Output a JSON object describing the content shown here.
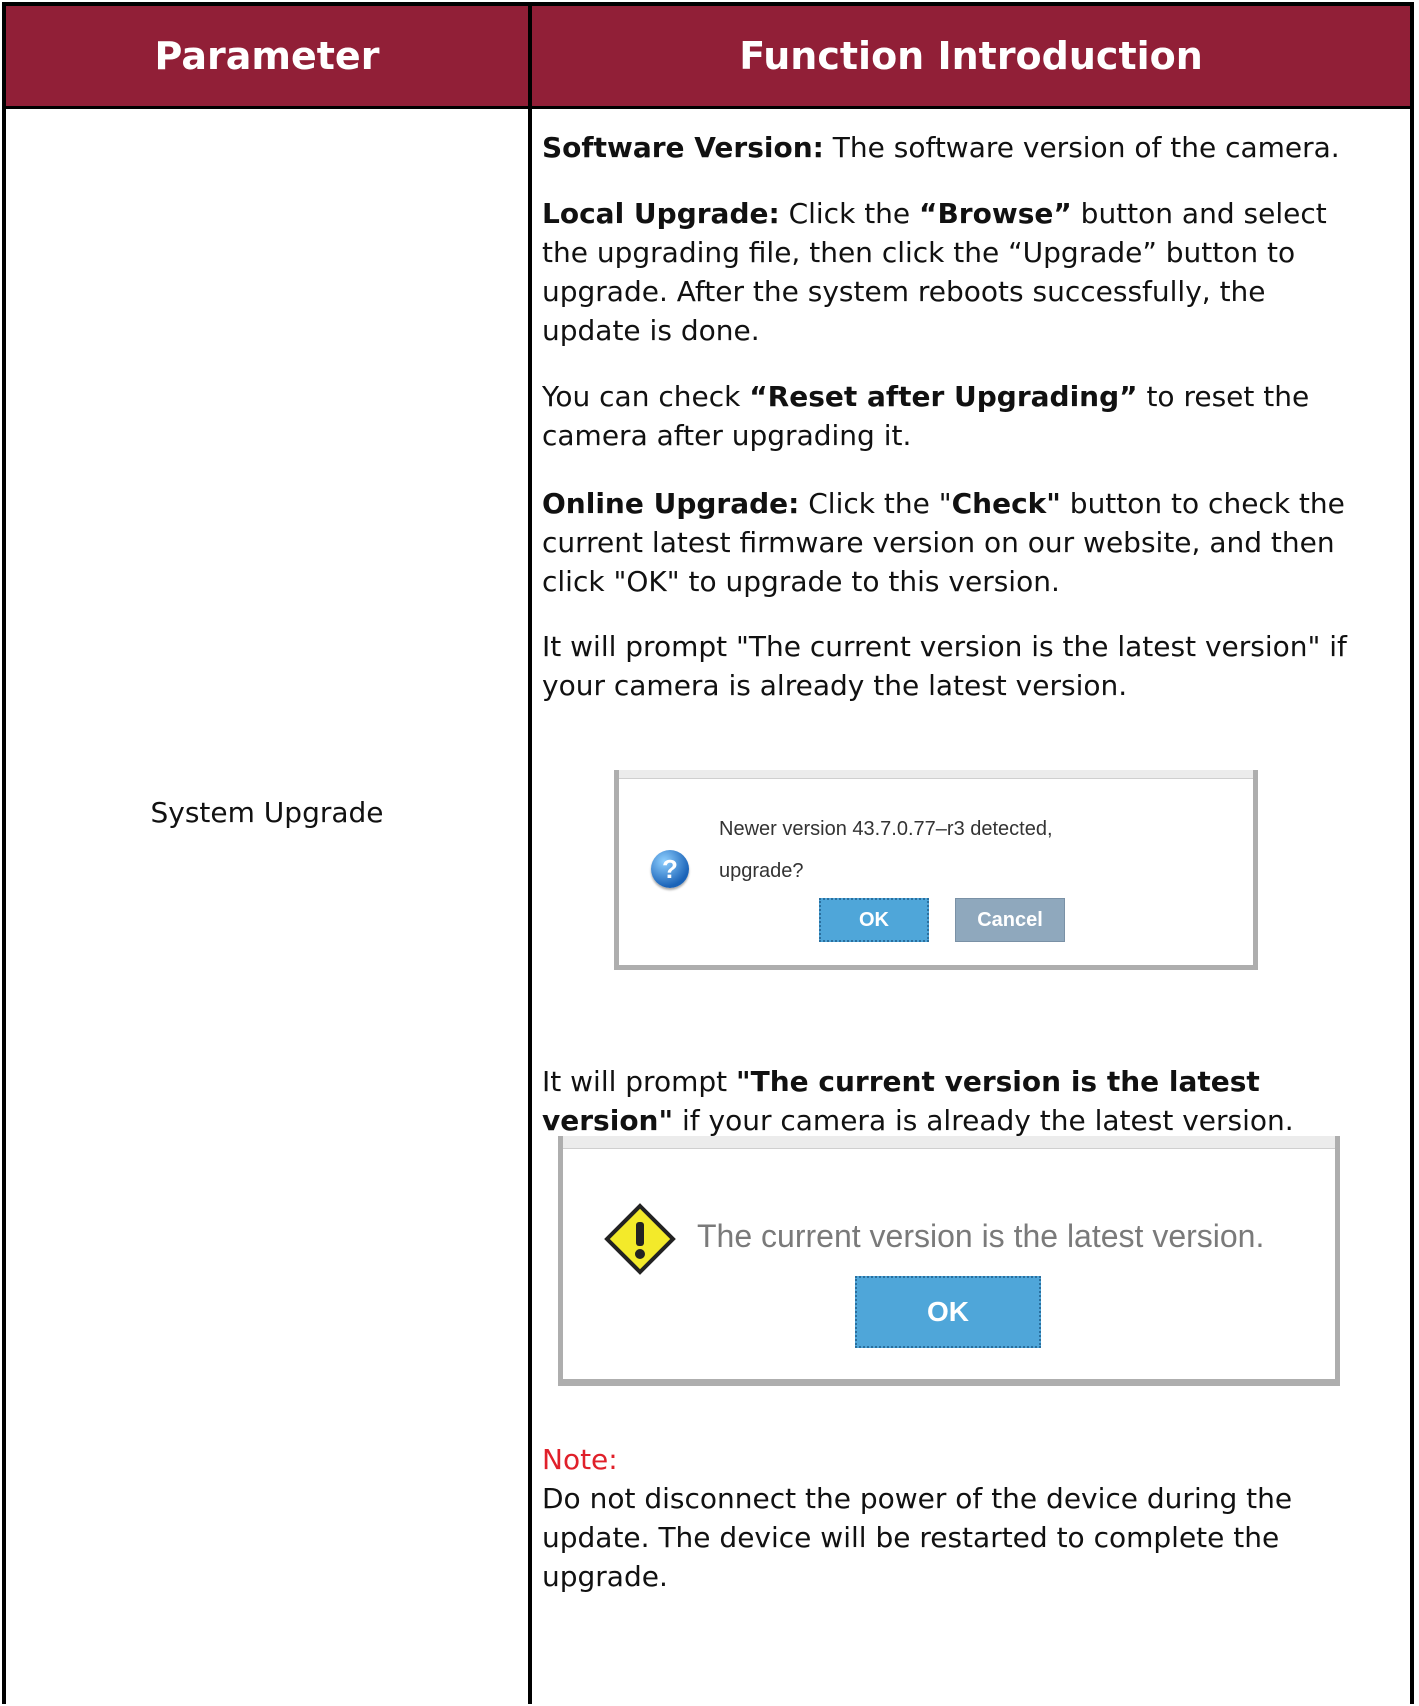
{
  "header": {
    "parameter": "Parameter",
    "function": "Function Introduction"
  },
  "row": {
    "parameter_name": "System Upgrade",
    "software_version": {
      "label": "Software Version:",
      "text": " The software version of the camera."
    },
    "local_upgrade": {
      "label": "Local Upgrade:",
      "text1": " Click the ",
      "browse": "“Browse”",
      "text2": " button and select the upgrading file, then click the “Upgrade” button to upgrade. After the system reboots successfully, the update is done."
    },
    "reset": {
      "text1": "You can check ",
      "reset_label": "“Reset after Upgrading”",
      "text2": " to reset the camera after upgrading it."
    },
    "online_upgrade": {
      "label": "Online Upgrade:",
      "text1": " Click the \"",
      "check": "Check\"",
      "text2": " button to check the current latest firmware version on our website, and then click \"OK\" to upgrade to this version."
    },
    "prompt1": "It will prompt \"The current version is the latest version\" if your camera is already the latest version.",
    "dialog_newer": {
      "icon": "question-icon",
      "line1": "Newer version 43.7.0.77–r3 detected,",
      "line2": "upgrade?",
      "ok": "OK",
      "cancel": "Cancel"
    },
    "prompt2": {
      "text1": "It will prompt ",
      "bold": "\"The current version is the latest version\"",
      "text2": " if your camera is already the latest version."
    },
    "dialog_latest": {
      "icon": "warning-icon",
      "message": "The current version is the latest version.",
      "ok": "OK"
    },
    "note": {
      "label": "Note:",
      "text": "Do not disconnect the power of the device during the update. The device will be restarted to complete the upgrade."
    }
  },
  "colors": {
    "header_bg": "#911f37",
    "note_label": "#e0202a",
    "dialog_button": "#4fa6d9",
    "cancel_button": "#8fa8bd"
  }
}
